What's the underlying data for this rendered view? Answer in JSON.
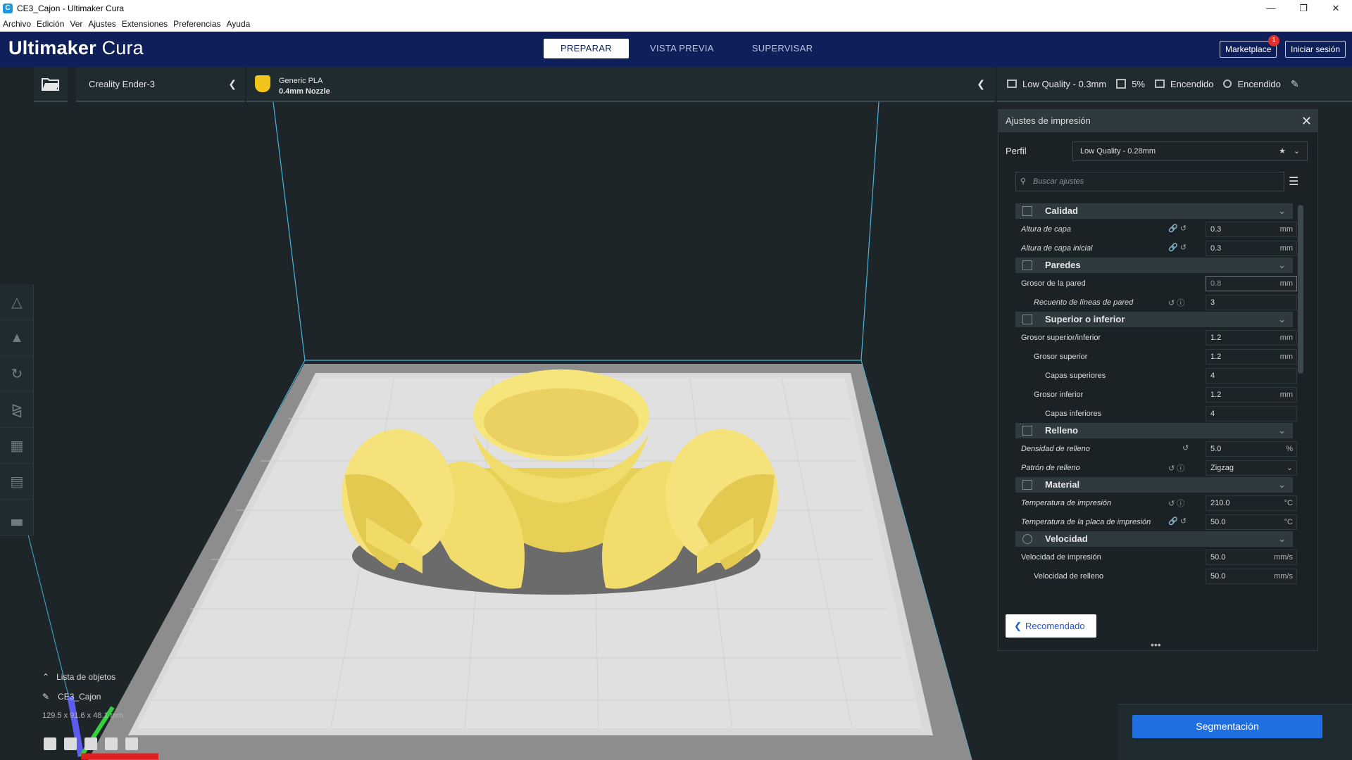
{
  "window": {
    "title": "CE3_Cajon - Ultimaker Cura",
    "app_icon": "C"
  },
  "menubar": [
    "Archivo",
    "Edición",
    "Ver",
    "Ajustes",
    "Extensiones",
    "Preferencias",
    "Ayuda"
  ],
  "header": {
    "logo_bold": "Ultimaker",
    "logo_rest": "Cura",
    "stages": [
      "PREPARAR",
      "VISTA PREVIA",
      "SUPERVISAR"
    ],
    "marketplace": "Marketplace",
    "marketplace_badge": "1",
    "signin": "Iniciar sesión"
  },
  "toolbar": {
    "printer": "Creality Ender-3",
    "material": "Generic PLA",
    "nozzle": "0.4mm Nozzle",
    "quality": "Low Quality - 0.3mm",
    "infill": "5%",
    "support": "Encendido",
    "adhesion": "Encendido"
  },
  "panel": {
    "title": "Ajustes de impresión",
    "profile_label": "Perfil",
    "profile_value": "Low Quality - 0.28mm",
    "search_placeholder": "Buscar ajustes",
    "recommended": "Recomendado"
  },
  "categories": [
    {
      "name": "Calidad",
      "rows": [
        {
          "label": "Altura de capa",
          "value": "0.3",
          "unit": "mm"
        },
        {
          "label": "Altura de capa inicial",
          "value": "0.3",
          "unit": "mm"
        }
      ]
    },
    {
      "name": "Paredes",
      "rows": [
        {
          "label": "Grosor de la pared",
          "value": "0.8",
          "unit": "mm"
        },
        {
          "label": "Recuento de líneas de pared",
          "value": "3",
          "unit": ""
        }
      ]
    },
    {
      "name": "Superior o inferior",
      "rows": [
        {
          "label": "Grosor superior/inferior",
          "value": "1.2",
          "unit": "mm"
        },
        {
          "label": "Grosor superior",
          "value": "1.2",
          "unit": "mm"
        },
        {
          "label": "Capas superiores",
          "value": "4",
          "unit": ""
        },
        {
          "label": "Grosor inferior",
          "value": "1.2",
          "unit": "mm"
        },
        {
          "label": "Capas inferiores",
          "value": "4",
          "unit": ""
        }
      ]
    },
    {
      "name": "Relleno",
      "rows": [
        {
          "label": "Densidad de relleno",
          "value": "5.0",
          "unit": "%"
        },
        {
          "label": "Patrón de relleno",
          "value": "Zigzag",
          "unit": ""
        }
      ]
    },
    {
      "name": "Material",
      "rows": [
        {
          "label": "Temperatura de impresión",
          "value": "210.0",
          "unit": "°C"
        },
        {
          "label": "Temperatura de la placa de impresión",
          "value": "50.0",
          "unit": "°C"
        }
      ]
    },
    {
      "name": "Velocidad",
      "rows": [
        {
          "label": "Velocidad de impresión",
          "value": "50.0",
          "unit": "mm/s"
        },
        {
          "label": "Velocidad de relleno",
          "value": "50.0",
          "unit": "mm/s"
        }
      ]
    }
  ],
  "objects": {
    "header": "Lista de objetos",
    "name": "CE3_Cajon",
    "dimensions": "129.5 x 91.6 x 48.1 mm"
  },
  "slice": {
    "label": "Segmentación"
  },
  "colors": {
    "header_bg": "#0f1f5a",
    "model": "#f4e36b",
    "accent": "#1f6fe0"
  }
}
